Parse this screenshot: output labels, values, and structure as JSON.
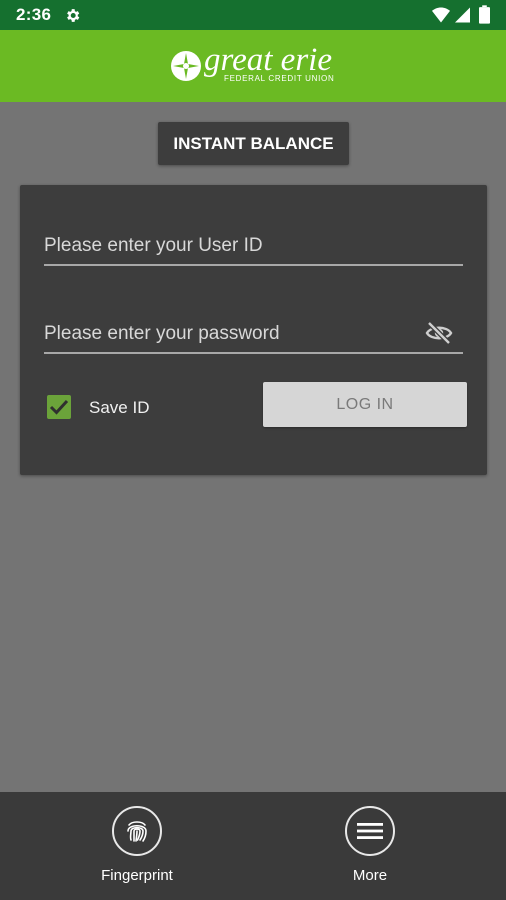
{
  "status_bar": {
    "time": "2:36",
    "icons": [
      "gear-icon",
      "wifi-icon",
      "signal-icon",
      "battery-icon"
    ]
  },
  "header": {
    "brand_name": "great erie",
    "brand_subtitle": "FEDERAL CREDIT UNION",
    "background_color": "#6bba23"
  },
  "instant_balance": {
    "label": "INSTANT BALANCE"
  },
  "login": {
    "userid": {
      "value": "",
      "placeholder": "Please enter your User ID"
    },
    "password": {
      "value": "",
      "placeholder": "Please enter your password",
      "toggle_icon": "eye-off-icon"
    },
    "save_id": {
      "label": "Save ID",
      "checked": true
    },
    "login_button": "LOG IN"
  },
  "bottom_nav": {
    "items": [
      {
        "label": "Fingerprint",
        "icon": "fingerprint-icon"
      },
      {
        "label": "More",
        "icon": "menu-icon"
      }
    ]
  },
  "colors": {
    "status_bar": "#15702f",
    "accent": "#6bba23",
    "checkbox": "#6ba33a",
    "card": "#3d3d3d",
    "page": "#747474"
  }
}
